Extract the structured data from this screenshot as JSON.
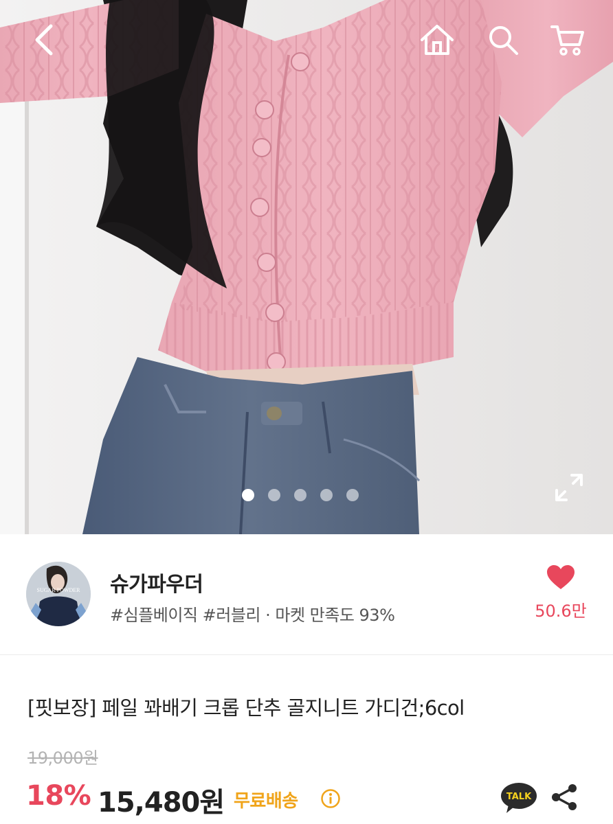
{
  "header": {
    "back_icon": "chevron-left-icon",
    "home_icon": "home-icon",
    "search_icon": "search-icon",
    "cart_icon": "cart-icon"
  },
  "gallery": {
    "image_count": 5,
    "active_index": 0,
    "expand_icon": "expand-icon"
  },
  "store": {
    "name": "슈가파우더",
    "tags": "#심플베이직 #러블리 · 마켓 만족도 93%",
    "avatar_text": "SUGAR POWDER",
    "like_count": "50.6만",
    "like_icon": "heart-icon"
  },
  "product": {
    "title": "[핏보장] 페일 꽈배기 크롭 단추 골지니트 가디건;6col",
    "original_price": "19,000원",
    "discount": "18%",
    "price": "15,480원",
    "shipping": "무료배송",
    "talk_label": "TALK",
    "share_icon": "share-icon"
  },
  "colors": {
    "accent": "#e8475c",
    "shipping": "#f0a41a",
    "talk_bg": "#2b2b2b"
  }
}
